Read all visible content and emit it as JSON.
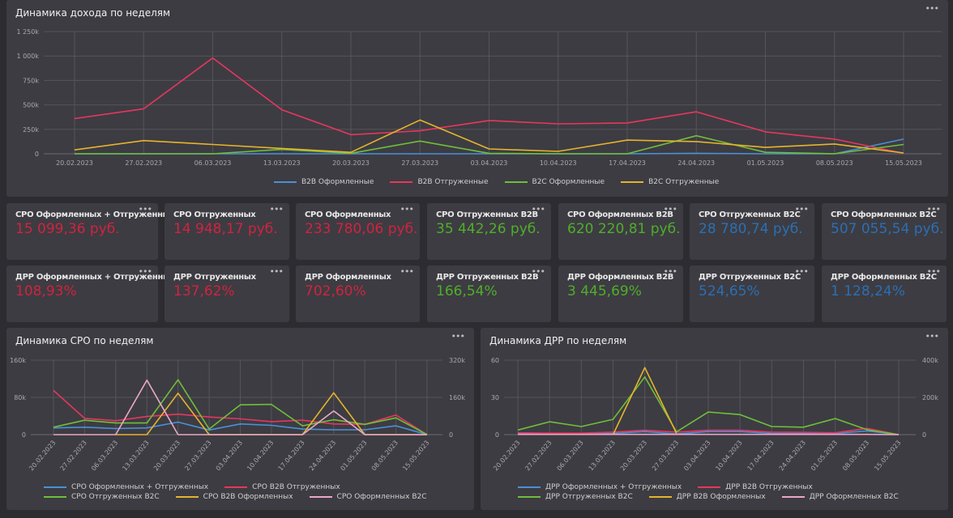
{
  "income_chart": {
    "title": "Динамика дохода по неделям",
    "menu": "•••",
    "chart_data": {
      "type": "line",
      "title": "Динамика дохода по неделям",
      "categories": [
        "20.02.2023",
        "27.02.2023",
        "06.03.2023",
        "13.03.2023",
        "20.03.2023",
        "27.03.2023",
        "03.04.2023",
        "10.04.2023",
        "17.04.2023",
        "24.04.2023",
        "01.05.2023",
        "08.05.2023",
        "15.05.2023"
      ],
      "y_ticks": [
        "0",
        "250k",
        "500k",
        "750k",
        "1 000k",
        "1 250k"
      ],
      "ylim": [
        0,
        1250000
      ],
      "grid": true,
      "legend": "bottom",
      "series": [
        {
          "name": "B2B Оформленные",
          "color": "#4a90d9",
          "values": [
            0,
            0,
            0,
            0,
            0,
            0,
            0,
            0,
            0,
            5000,
            0,
            0,
            150000
          ]
        },
        {
          "name": "B2B Отгруженные",
          "color": "#e8365e",
          "values": [
            360000,
            460000,
            980000,
            450000,
            195000,
            235000,
            340000,
            306000,
            315000,
            430000,
            224000,
            150000,
            5000
          ]
        },
        {
          "name": "B2C Оформленные",
          "color": "#6fbf3a",
          "values": [
            0,
            0,
            0,
            45000,
            5000,
            130000,
            5000,
            0,
            0,
            185000,
            15000,
            0,
            95000
          ]
        },
        {
          "name": "B2C Отгруженные",
          "color": "#e6b42c",
          "values": [
            40000,
            135000,
            95000,
            55000,
            15000,
            345000,
            50000,
            25000,
            140000,
            125000,
            65000,
            100000,
            8000
          ]
        }
      ]
    }
  },
  "kpi_rows": [
    [
      {
        "label": "СРО Оформленных + Отгруженных",
        "value": "15 099,36 руб.",
        "color": "#d0233f"
      },
      {
        "label": "СРО Отгруженных",
        "value": "14 948,17 руб.",
        "color": "#d0233f"
      },
      {
        "label": "СРО Оформленных",
        "value": "233 780,06 руб.",
        "color": "#d0233f"
      },
      {
        "label": "СРО Отгруженных B2B",
        "value": "35 442,26 руб.",
        "color": "#4fae2a"
      },
      {
        "label": "СРО Оформленных B2B",
        "value": "620 220,81 руб.",
        "color": "#4fae2a"
      },
      {
        "label": "СРО Отгруженных B2C",
        "value": "28 780,74 руб.",
        "color": "#2a6fb5"
      },
      {
        "label": "СРО Оформленных B2C",
        "value": "507 055,54 руб.",
        "color": "#2a6fb5"
      }
    ],
    [
      {
        "label": "ДРР Оформленных + Отгруженных",
        "value": "108,93%",
        "color": "#d0233f"
      },
      {
        "label": "ДРР Отгруженных",
        "value": "137,62%",
        "color": "#d0233f"
      },
      {
        "label": "ДРР Оформленных",
        "value": "702,60%",
        "color": "#d0233f"
      },
      {
        "label": "ДРР Отгруженных B2B",
        "value": "166,54%",
        "color": "#4fae2a"
      },
      {
        "label": "ДРР Оформленных B2B",
        "value": "3 445,69%",
        "color": "#4fae2a"
      },
      {
        "label": "ДРР Отгруженных B2C",
        "value": "524,65%",
        "color": "#2a6fb5"
      },
      {
        "label": "ДРР Оформленных B2C",
        "value": "1 128,24%",
        "color": "#2a6fb5"
      }
    ]
  ],
  "cpo_chart": {
    "title": "Динамика СРО по неделям",
    "menu": "•••",
    "chart_data": {
      "type": "line",
      "title": "Динамика СРО по неделям",
      "categories": [
        "20.02.2023",
        "27.02.2023",
        "06.03.2023",
        "13.03.2023",
        "20.03.2023",
        "27.03.2023",
        "03.04.2023",
        "10.04.2023",
        "17.04.2023",
        "24.04.2023",
        "01.05.2023",
        "08.05.2023",
        "15.05.2023"
      ],
      "y_ticks": [
        "0",
        "80k",
        "160k"
      ],
      "y2_ticks": [
        "0",
        "160k",
        "320k"
      ],
      "ylim": [
        0,
        160000
      ],
      "y2lim": [
        0,
        320000
      ],
      "grid": true,
      "legend": "bottom",
      "series": [
        {
          "name": "СРО Оформленных + Отгруженных",
          "color": "#4a90d9",
          "values": [
            14500,
            16000,
            13000,
            14500,
            27000,
            10000,
            23000,
            20000,
            12000,
            10500,
            10500,
            19000,
            0
          ]
        },
        {
          "name": "СРО B2B Отгруженных",
          "color": "#e8365e",
          "values": [
            95000,
            35000,
            30000,
            39000,
            44000,
            38000,
            34000,
            28000,
            31000,
            23000,
            22000,
            42000,
            0
          ]
        },
        {
          "name": "СРО Отгруженных B2C",
          "color": "#6fbf3a",
          "values": [
            16000,
            31000,
            25000,
            25000,
            118000,
            12000,
            64000,
            65000,
            19000,
            32000,
            22000,
            36000,
            0
          ]
        },
        {
          "name": "СРО B2B Оформленных",
          "color": "#e6b42c",
          "values": [
            null,
            null,
            0,
            0,
            89000,
            0,
            0,
            0,
            0,
            90000,
            0,
            0,
            0
          ]
        },
        {
          "name": "СРО Оформленных B2C",
          "color": "#e9a8c8",
          "values": [
            0,
            0,
            0,
            117000,
            0,
            0,
            0,
            0,
            0,
            51000,
            0,
            0,
            0
          ]
        }
      ]
    }
  },
  "drr_chart": {
    "title": "Динамика ДРР по неделям",
    "menu": "•••",
    "chart_data": {
      "type": "line",
      "title": "Динамика ДРР по неделям",
      "categories": [
        "20.02.2023",
        "27.02.2023",
        "06.03.2023",
        "13.03.2023",
        "20.03.2023",
        "27.03.2023",
        "03.04.2023",
        "10.04.2023",
        "17.04.2023",
        "24.04.2023",
        "01.05.2023",
        "08.05.2023",
        "15.05.2023"
      ],
      "y_ticks": [
        "0",
        "30",
        "60"
      ],
      "y2_ticks": [
        "0",
        "200k",
        "400k"
      ],
      "ylim": [
        0,
        60
      ],
      "y2lim": [
        0,
        400000
      ],
      "grid": true,
      "legend": "bottom",
      "series": [
        {
          "name": "ДРР Оформленных + Отгруженных",
          "color": "#4a90d9",
          "values": [
            0.5,
            0.5,
            0.5,
            1,
            2.5,
            0.5,
            2.5,
            2.5,
            1,
            1,
            1,
            3,
            0
          ]
        },
        {
          "name": "ДРР B2B Отгруженных",
          "color": "#e8365e",
          "values": [
            1.5,
            1.2,
            1.2,
            2,
            3.5,
            2,
            3.5,
            3.5,
            2,
            1.8,
            1.5,
            5,
            0
          ]
        },
        {
          "name": "ДРР Отгруженных B2C",
          "color": "#6fbf3a",
          "values": [
            3.7,
            10.4,
            6.5,
            12.3,
            46.5,
            2.2,
            18.2,
            16.2,
            6.5,
            6,
            13,
            4,
            0
          ]
        },
        {
          "name": "ДРР B2B Оформленных",
          "color": "#e6b42c",
          "values": [
            null,
            null,
            null,
            0,
            54,
            1,
            null,
            null,
            null,
            null,
            null,
            null,
            null
          ]
        },
        {
          "name": "ДРР Оформленных B2C",
          "color": "#e9a8c8",
          "values": [
            0.2,
            0.2,
            0.2,
            0.2,
            0.2,
            0.2,
            0.2,
            0.2,
            0.2,
            0.2,
            0.2,
            0.2,
            0
          ]
        }
      ]
    }
  }
}
